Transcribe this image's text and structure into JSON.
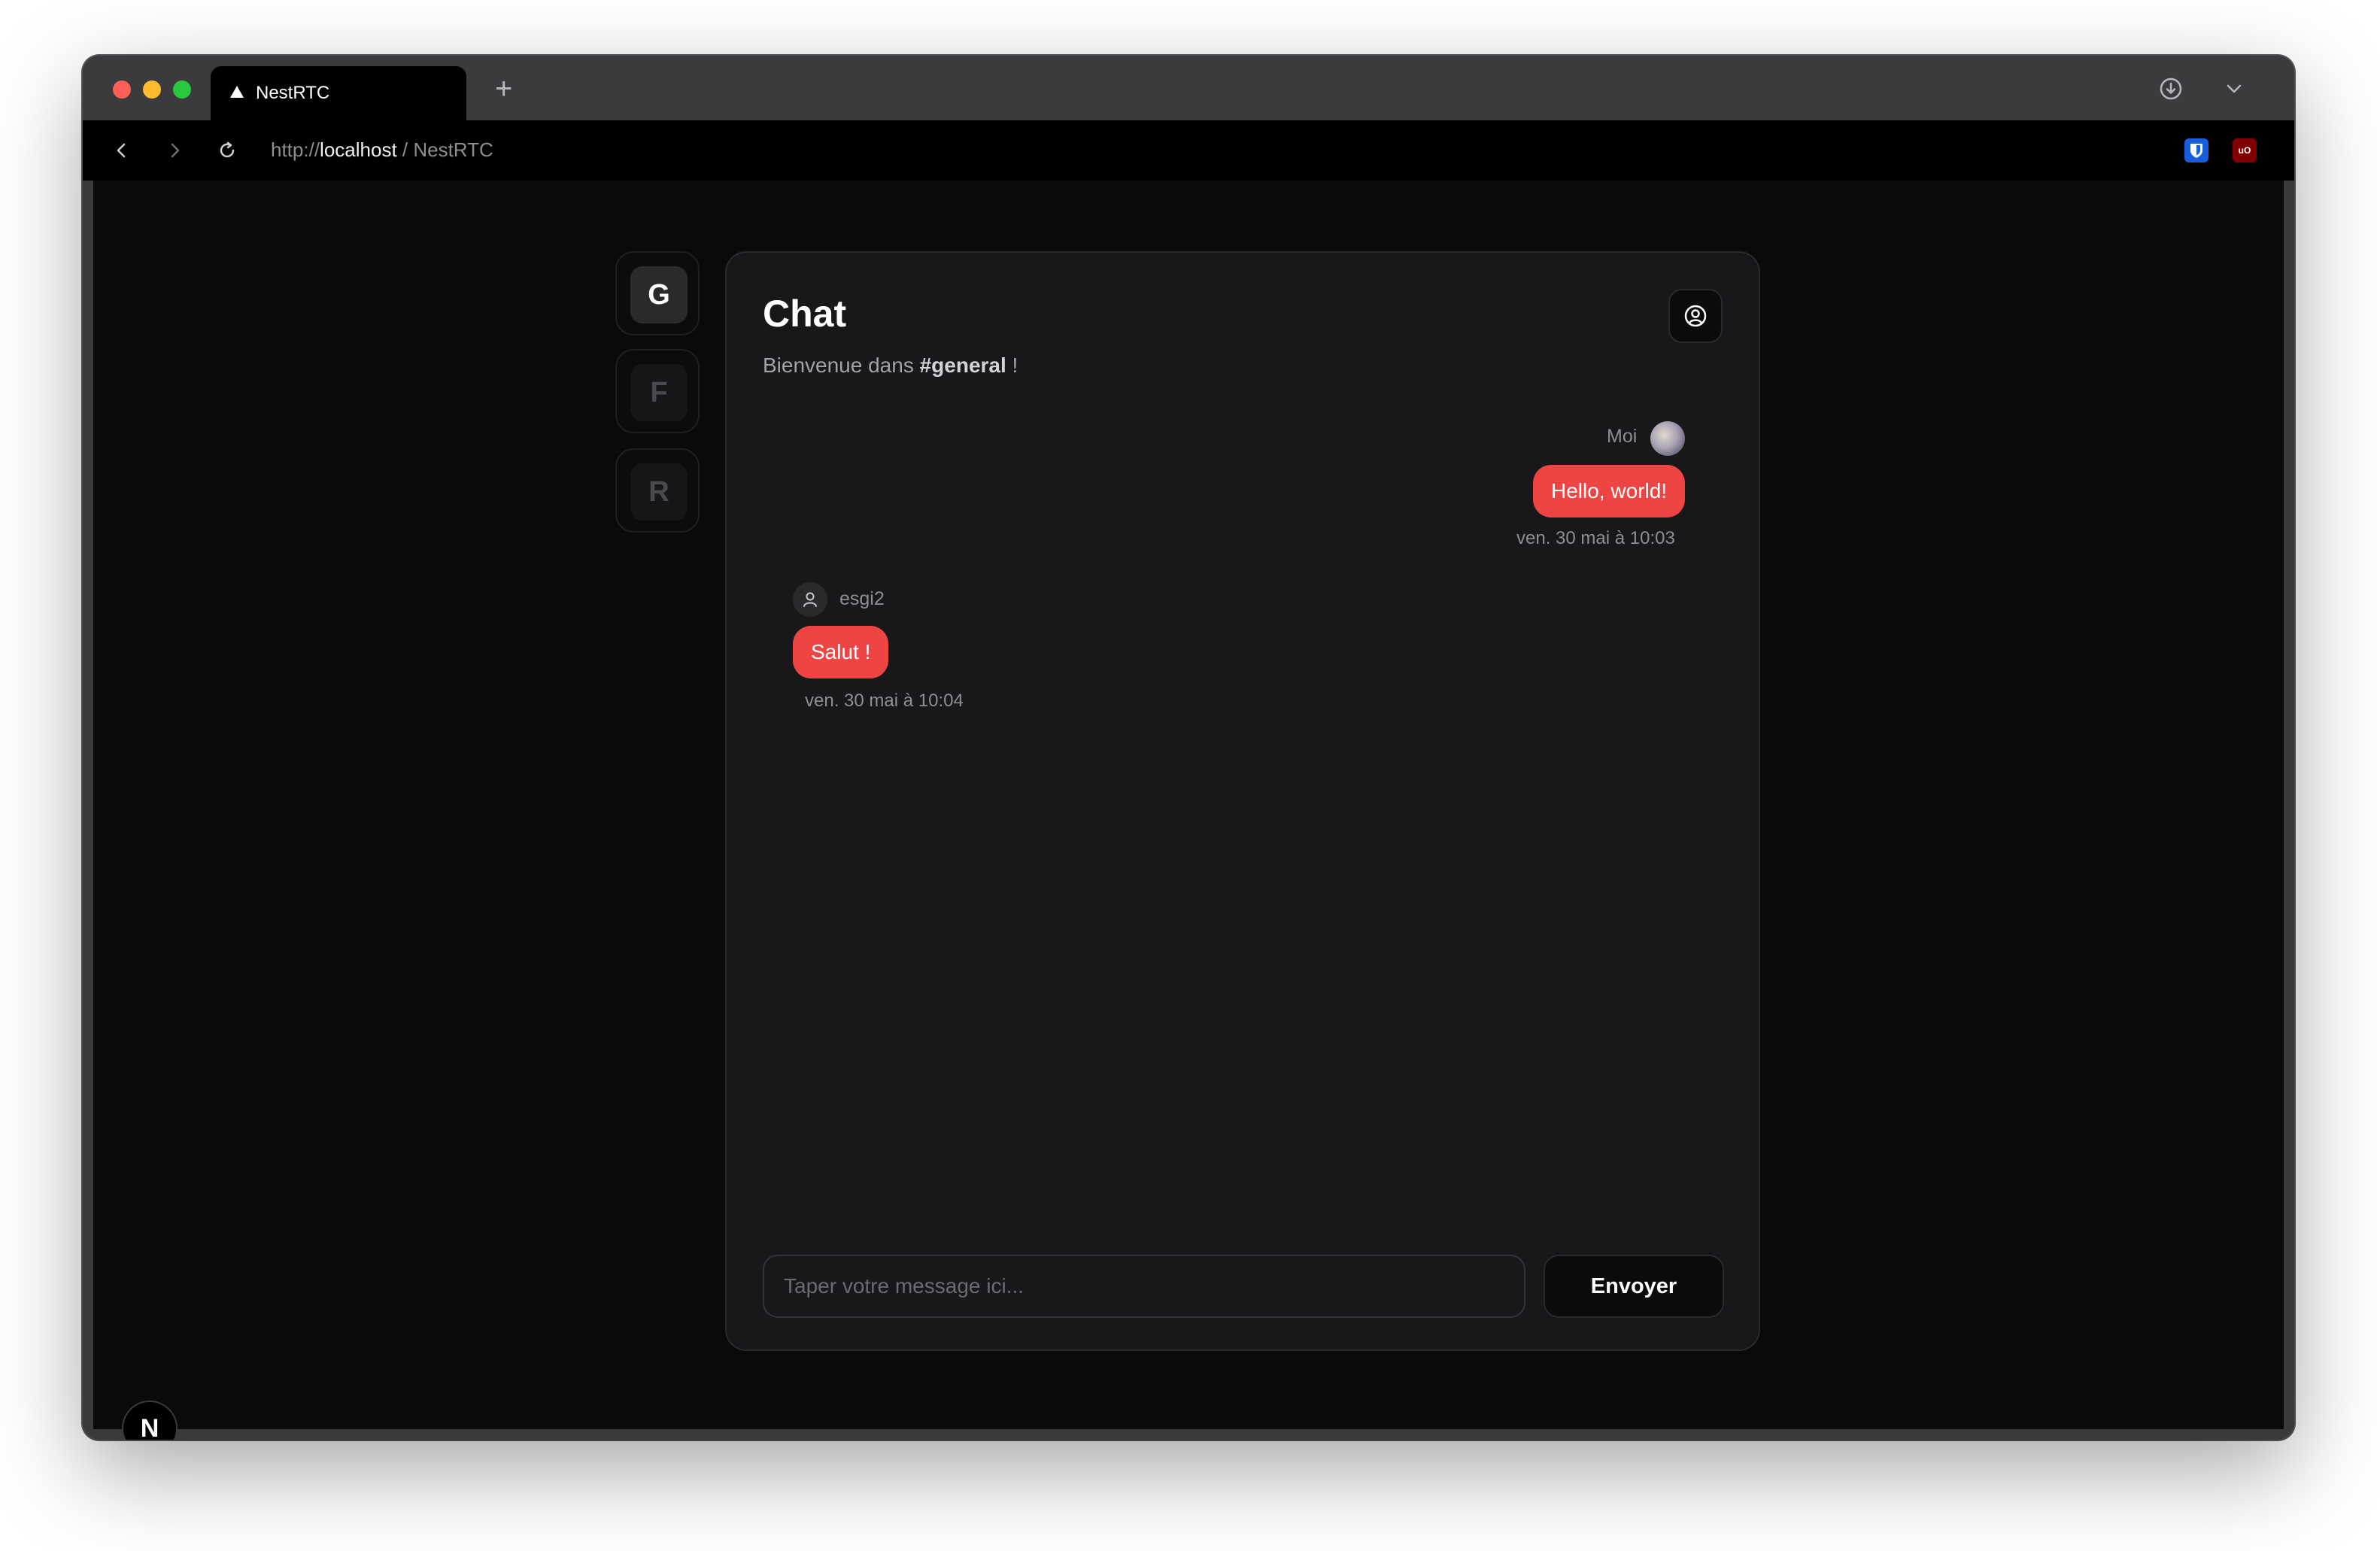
{
  "browser": {
    "tab_title": "NestRTC",
    "new_tab_label": "+",
    "url_scheme": "http://",
    "url_host": "localhost",
    "url_path": " / NestRTC",
    "extensions": {
      "ublock_label": "uO"
    }
  },
  "servers": [
    {
      "letter": "G",
      "active": true
    },
    {
      "letter": "F",
      "active": false
    },
    {
      "letter": "R",
      "active": false
    }
  ],
  "chat": {
    "title": "Chat",
    "welcome_prefix": "Bienvenue dans ",
    "channel": "#general",
    "welcome_suffix": " !",
    "messages": [
      {
        "author": "Moi",
        "text": "Hello, world!",
        "time": "ven. 30 mai à 10:03",
        "own": true
      },
      {
        "author": "esgi2",
        "text": "Salut !",
        "time": "ven. 30 mai à 10:04",
        "own": false
      }
    ],
    "input_placeholder": "Taper votre message ici...",
    "send_label": "Envoyer"
  },
  "dev_badge": {
    "letter": "N"
  },
  "colors": {
    "accent": "#ef4444",
    "background": "#0a0a0b",
    "card": "#18181b"
  }
}
